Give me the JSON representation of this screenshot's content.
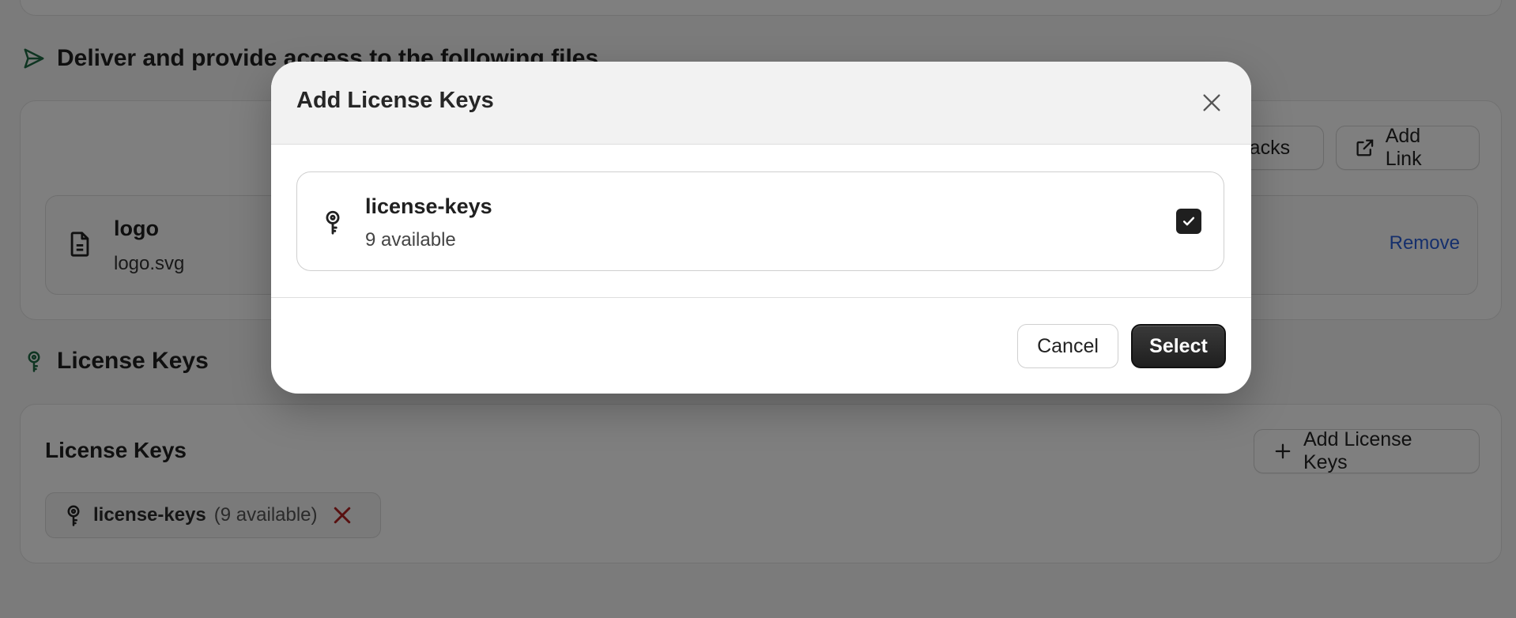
{
  "background": {
    "deliver_section": {
      "heading": "Deliver and provide access to the following files",
      "buttons": {
        "packs_label": "Packs",
        "add_link_label": "Add Link"
      },
      "file": {
        "name": "logo",
        "filename": "logo.svg",
        "remove_label": "Remove"
      }
    },
    "license_section": {
      "heading": "License Keys",
      "card_title": "License Keys",
      "add_button_label": "Add License Keys",
      "chip": {
        "name": "license-keys",
        "count": "(9 available)"
      }
    }
  },
  "modal": {
    "title": "Add License Keys",
    "option": {
      "name": "license-keys",
      "availability": "9 available",
      "checked": true
    },
    "cancel_label": "Cancel",
    "select_label": "Select"
  },
  "colors": {
    "accent_green": "#1f6b45",
    "link_blue": "#2b5fd9",
    "danger_red": "#b02020",
    "primary_dark": "#1f1f1f"
  },
  "icons": [
    "send-icon",
    "link-external-icon",
    "file-icon",
    "key-icon",
    "plus-icon",
    "x-icon",
    "close-icon",
    "check-icon"
  ]
}
